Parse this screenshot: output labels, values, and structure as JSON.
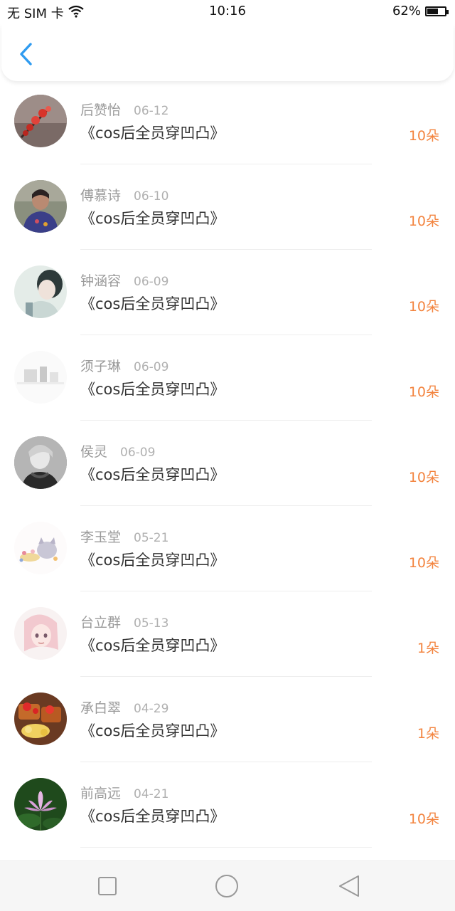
{
  "status_bar": {
    "carrier": "无 SIM 卡",
    "time": "10:16",
    "battery": "62%",
    "battery_level": 0.62
  },
  "header": {
    "back_icon": "chevron-left-icon"
  },
  "list": [
    {
      "name": "后赞怡",
      "date": "06-12",
      "title": "《cos后全员穿凹凸》",
      "flowers": "10朵"
    },
    {
      "name": "傅慕诗",
      "date": "06-10",
      "title": "《cos后全员穿凹凸》",
      "flowers": "10朵"
    },
    {
      "name": "钟涵容",
      "date": "06-09",
      "title": "《cos后全员穿凹凸》",
      "flowers": "10朵"
    },
    {
      "name": "须子琳",
      "date": "06-09",
      "title": "《cos后全员穿凹凸》",
      "flowers": "10朵"
    },
    {
      "name": "侯灵",
      "date": "06-09",
      "title": "《cos后全员穿凹凸》",
      "flowers": "10朵"
    },
    {
      "name": "李玉堂",
      "date": "05-21",
      "title": "《cos后全员穿凹凸》",
      "flowers": "10朵"
    },
    {
      "name": "台立群",
      "date": "05-13",
      "title": "《cos后全员穿凹凸》",
      "flowers": "1朵"
    },
    {
      "name": "承白翠",
      "date": "04-29",
      "title": "《cos后全员穿凹凸》",
      "flowers": "1朵"
    },
    {
      "name": "前高远",
      "date": "04-21",
      "title": "《cos后全员穿凹凸》",
      "flowers": "10朵"
    }
  ],
  "nav_bar": {
    "recents_icon": "square-icon",
    "home_icon": "circle-icon",
    "back_icon": "triangle-back-icon"
  },
  "colors": {
    "accent": "#2f9bf0",
    "flower_count": "#f3843f",
    "name_text": "#9a9a9a",
    "title_text": "#333333"
  }
}
